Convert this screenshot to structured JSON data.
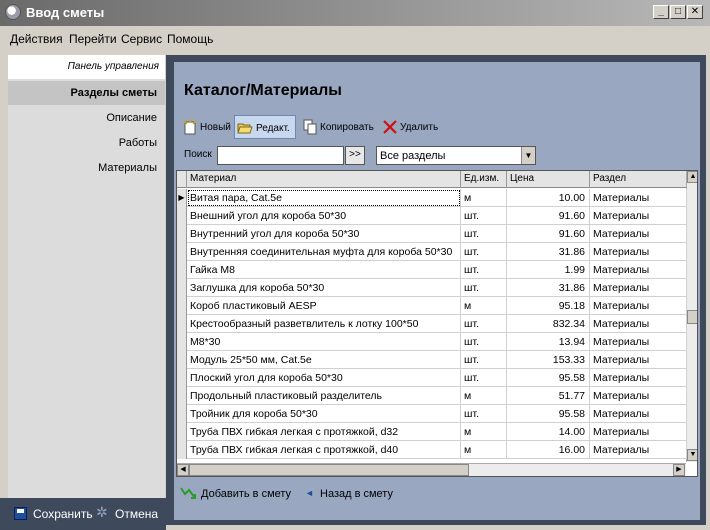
{
  "window": {
    "title": "Ввод сметы"
  },
  "menu": [
    "Действия",
    "Перейти",
    "Сервис",
    "Помощь"
  ],
  "sidebar": {
    "header": "Панель управления",
    "active": "Разделы сметы",
    "items": [
      "Описание",
      "Работы",
      "Материалы"
    ]
  },
  "bottom": {
    "save": "Сохранить",
    "cancel": "Отмена"
  },
  "page": {
    "title": "Каталог/Материалы"
  },
  "toolbar": {
    "new": "Новый",
    "edit": "Редакт.",
    "copy": "Копировать",
    "delete": "Удалить"
  },
  "search": {
    "label": "Поиск",
    "value": "",
    "go": ">>",
    "section": "Все разделы"
  },
  "table": {
    "headers": [
      "Материал",
      "Ед.изм.",
      "Цена",
      "Раздел"
    ],
    "rows": [
      [
        "Витая пара, Cat.5e",
        "м",
        "10.00",
        "Материалы"
      ],
      [
        "Внешний угол для короба 50*30",
        "шт.",
        "91.60",
        "Материалы"
      ],
      [
        "Внутренний угол для короба 50*30",
        "шт.",
        "91.60",
        "Материалы"
      ],
      [
        "Внутренняя соединительная муфта для короба 50*30",
        "шт.",
        "31.86",
        "Материалы"
      ],
      [
        "Гайка М8",
        "шт.",
        "1.99",
        "Материалы"
      ],
      [
        "Заглушка для короба 50*30",
        "шт.",
        "31.86",
        "Материалы"
      ],
      [
        "Короб пластиковый AESP",
        "м",
        "95.18",
        "Материалы"
      ],
      [
        "Крестообразный разветвлитель к лотку 100*50",
        "шт.",
        "832.34",
        "Материалы"
      ],
      [
        "М8*30",
        "шт.",
        "13.94",
        "Материалы"
      ],
      [
        "Модуль 25*50 мм, Cat.5e",
        "шт.",
        "153.33",
        "Материалы"
      ],
      [
        "Плоский угол для короба 50*30",
        "шт.",
        "95.58",
        "Материалы"
      ],
      [
        "Продольный пластиковый разделитель",
        "м",
        "51.77",
        "Материалы"
      ],
      [
        "Тройник для короба 50*30",
        "шт.",
        "95.58",
        "Материалы"
      ],
      [
        "Труба ПВХ гибкая легкая с протяжкой, d32",
        "м",
        "14.00",
        "Материалы"
      ],
      [
        "Труба ПВХ гибкая легкая с протяжкой, d40",
        "м",
        "16.00",
        "Материалы"
      ]
    ]
  },
  "footer": {
    "add": "Добавить в смету",
    "back": "Назад в смету"
  },
  "colors": {
    "frame": "#3e4a5c",
    "panel": "#99a8c0",
    "titlebar": "#6a6a6a"
  }
}
